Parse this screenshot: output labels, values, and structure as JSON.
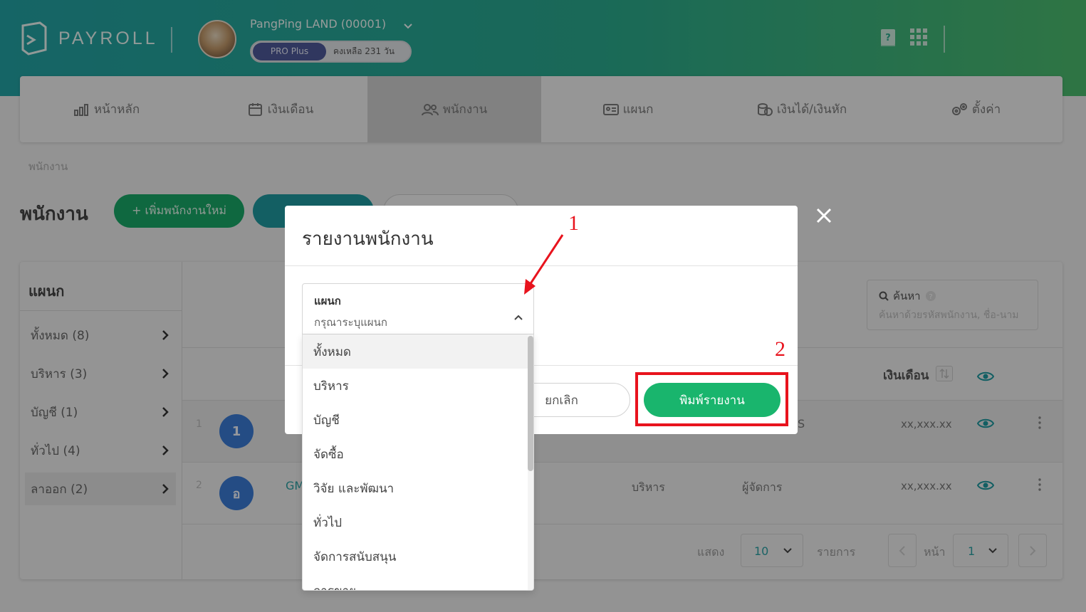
{
  "header": {
    "brand": "PAYROLL",
    "company": "PangPing LAND (00001)",
    "plan": "PRO Plus",
    "remaining": "คงเหลือ 231 วัน",
    "icons": [
      "help-book-icon",
      "apps-grid-icon"
    ]
  },
  "nav": {
    "items": [
      {
        "label": "หน้าหลัก",
        "icon": "chart-icon"
      },
      {
        "label": "เงินเดือน",
        "icon": "calendar-icon"
      },
      {
        "label": "พนักงาน",
        "icon": "users-icon"
      },
      {
        "label": "แผนก",
        "icon": "id-card-icon"
      },
      {
        "label": "เงินได้/เงินหัก",
        "icon": "money-icon"
      },
      {
        "label": "ตั้งค่า",
        "icon": "gears-icon"
      }
    ],
    "active": "พนักงาน"
  },
  "page": {
    "breadcrumb": "พนักงาน",
    "title": "พนักงาน",
    "add_button": "+ เพิ่มพนักงานใหม่"
  },
  "departments": {
    "heading": "แผนก",
    "items": [
      "ทั้งหมด (8)",
      "บริหาร (3)",
      "บัญชี (1)",
      "ทั่วไป (4)",
      "ลาออก (2)"
    ],
    "selected": "ลาออก (2)"
  },
  "search": {
    "label": "ค้นหา",
    "placeholder": "ค้นหาด้วยรหัสพนักงาน, ชื่อ-นาม"
  },
  "table": {
    "salary_header": "เงินเดือน",
    "rows": [
      {
        "no": "1",
        "avatar": "1",
        "code": "",
        "dept": "",
        "position": "S",
        "salary": "xx,xxx.xx"
      },
      {
        "no": "2",
        "avatar": "อ",
        "code": "GM",
        "dept": "บริหาร",
        "position": "ผู้จัดการ",
        "salary": "xx,xxx.xx"
      }
    ]
  },
  "pagination": {
    "show_label": "แสดง",
    "page_size": "10",
    "items_label": "รายการ",
    "page_label": "หน้า",
    "page": "1"
  },
  "modal": {
    "title": "รายงานพนักงาน",
    "field_label": "แผนก",
    "field_placeholder": "กรุณาระบุแผนก",
    "options": [
      "ทั้งหมด",
      "บริหาร",
      "บัญชี",
      "จัดซื้อ",
      "วิจัย และพัฒนา",
      "ทั่วไป",
      "จัดการสนับสนุน",
      "การขาย"
    ],
    "hovered_option": "ทั้งหมด",
    "cancel": "ยกเลิก",
    "print": "พิมพ์รายงาน"
  },
  "annotations": {
    "step1": "1",
    "step2": "2",
    "color": "#e8131d"
  },
  "colors": {
    "brand_green": "#19a968",
    "teal": "#23a3a5",
    "print_green": "#19b56d",
    "plan_badge": "#4e5a9a"
  }
}
